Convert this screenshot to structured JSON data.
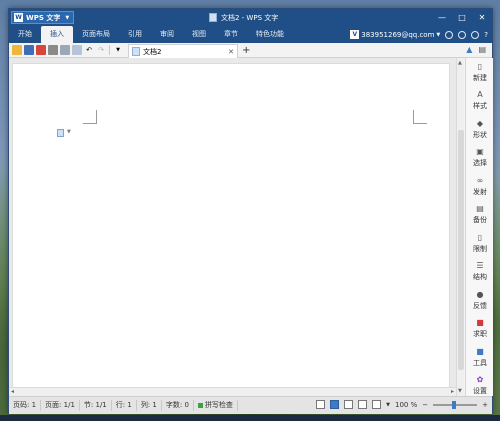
{
  "titlebar": {
    "app_label": "WPS 文字",
    "window_title": "文档2 - WPS 文字",
    "minimize": "—",
    "maximize": "□",
    "close": "✕"
  },
  "menubar": {
    "items": [
      "开始",
      "插入",
      "页面布局",
      "引用",
      "审阅",
      "视图",
      "章节",
      "特色功能"
    ],
    "active_index": 1,
    "user_email": "383951269@qq.com",
    "help": "?"
  },
  "toolbar": {
    "doc_tab_label": "文档2",
    "close_tab": "✕",
    "new_tab": "+"
  },
  "taskpane": {
    "items": [
      {
        "label": "新建",
        "icon": "new-doc-icon"
      },
      {
        "label": "样式",
        "icon": "style-icon"
      },
      {
        "label": "形状",
        "icon": "shape-icon"
      },
      {
        "label": "选择",
        "icon": "select-icon"
      },
      {
        "label": "发射",
        "icon": "link-icon"
      },
      {
        "label": "备份",
        "icon": "backup-icon"
      },
      {
        "label": "限制",
        "icon": "restrict-icon"
      },
      {
        "label": "结构",
        "icon": "structure-icon"
      },
      {
        "label": "反馈",
        "icon": "feedback-icon"
      },
      {
        "label": "求职",
        "icon": "job-icon"
      },
      {
        "label": "工具",
        "icon": "tools-icon"
      },
      {
        "label": "设置",
        "icon": "settings-icon"
      }
    ]
  },
  "statusbar": {
    "page": "页码: 1",
    "pages": "页面: 1/1",
    "section": "节: 1/1",
    "row": "行: 1",
    "col": "列: 1",
    "words": "字数: 0",
    "spellcheck": "拼写检查",
    "zoom": "100 %"
  },
  "colors": {
    "title_bg": "#1f4f86",
    "accent": "#3d7bc6"
  }
}
